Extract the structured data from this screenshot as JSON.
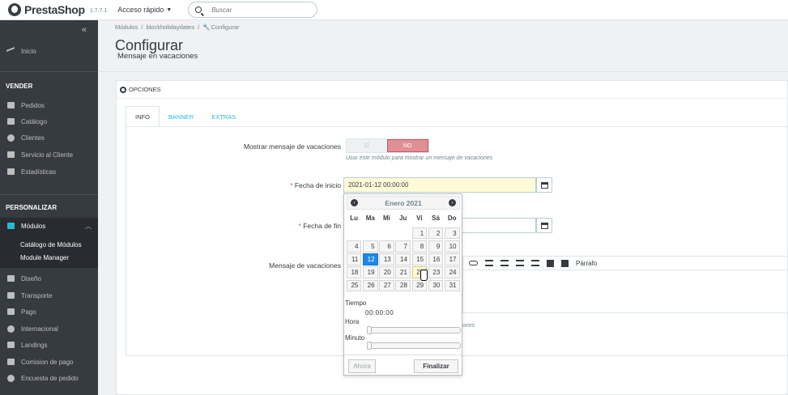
{
  "topbar": {
    "logo_text": "PrestaShop",
    "version": "1.7.7.1",
    "quick_access": "Acceso rápido",
    "search_placeholder": "Buscar"
  },
  "sidebar": {
    "collapse": "«",
    "dashboard": "Inicio",
    "section_sell": "VENDER",
    "sell_items": [
      "Pedidos",
      "Catálogo",
      "Clientes",
      "Servicio al Cliente",
      "Estadísticas"
    ],
    "section_customize": "PERSONALIZAR",
    "modules_label": "Módulos",
    "modules_sub": [
      "Catálogo de Módulos",
      "Module Manager"
    ],
    "more_items": [
      "Diseño",
      "Transporte",
      "Pago",
      "Internacional",
      "Landings",
      "Comision de pago",
      "Encuesta de pedido"
    ]
  },
  "breadcrumb": [
    "Módulos",
    "/",
    "blockholidaydates",
    "/",
    "Configurar"
  ],
  "header": {
    "title": "Configurar",
    "subtitle": "Mensaje en vacaciones"
  },
  "panel": {
    "title": "OPCIONES",
    "tabs": [
      "INFO",
      "BANNER",
      "EXTRAS"
    ]
  },
  "form": {
    "show_message_label": "Mostrar mensaje de vacaciones",
    "toggle_yes": "SÍ",
    "toggle_no": "NO",
    "toggle_selected": "NO",
    "show_message_help": "Usar este módulo para mostrar un mensaje de vacaciones",
    "start_date_label": "Fecha de inicio",
    "start_date_value": "2021-01-12 00:00:00",
    "end_date_label": "Fecha de fin",
    "end_date_value": "",
    "message_label": "Mensaje de vacaciones",
    "format_label": "Párrafo",
    "partial_help": "ones",
    "required_mark": "*"
  },
  "datepicker": {
    "month": "Enero 2021",
    "prev": "‹",
    "next": "›",
    "weekdays": [
      "Lu",
      "Ma",
      "Mi",
      "Ju",
      "Vi",
      "Sá",
      "Do"
    ],
    "days": [
      "",
      "",
      "",
      "",
      "1",
      "2",
      "3",
      "4",
      "5",
      "6",
      "7",
      "8",
      "9",
      "10",
      "11",
      "12",
      "13",
      "14",
      "15",
      "16",
      "17",
      "18",
      "19",
      "20",
      "21",
      "22",
      "23",
      "24",
      "25",
      "26",
      "27",
      "28",
      "29",
      "30",
      "31"
    ],
    "selected_day": "12",
    "hover_day": "22",
    "time_label": "Tiempo",
    "time_value": "00:00:00",
    "hour_label": "Hora",
    "minute_label": "Minuto",
    "hour_value": 0,
    "minute_value": 0,
    "now_button": "Ahora",
    "done_button": "Finalizar"
  }
}
